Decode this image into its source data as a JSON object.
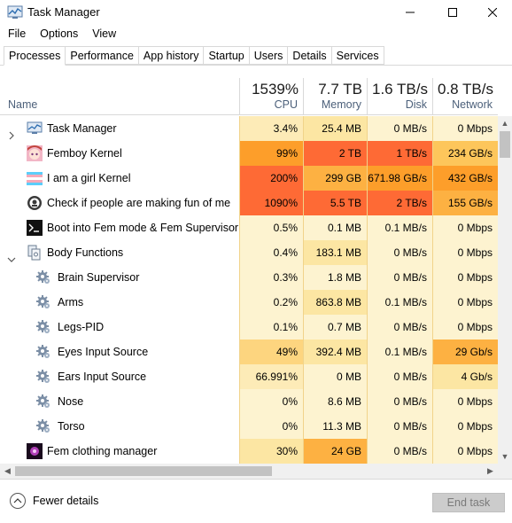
{
  "window": {
    "title": "Task Manager"
  },
  "menu": [
    "File",
    "Options",
    "View"
  ],
  "tabs": [
    "Processes",
    "Performance",
    "App history",
    "Startup",
    "Users",
    "Details",
    "Services"
  ],
  "header": {
    "name_label": "Name",
    "cpu": {
      "pct": "1539%",
      "label": "CPU"
    },
    "memory": {
      "pct": "7.7 TB",
      "label": "Memory"
    },
    "disk": {
      "pct": "1.6 TB/s",
      "label": "Disk"
    },
    "network": {
      "pct": "0.8 TB/s",
      "label": "Network"
    }
  },
  "rows": [
    {
      "name": "Task Manager",
      "icon": "task-manager-icon",
      "expander": "collapsed",
      "indent": 0,
      "cpu": "3.4%",
      "mem": "25.4 MB",
      "disk": "0 MB/s",
      "net": "0 Mbps",
      "colors": [
        "#fdebb7",
        "#fce6a3",
        "#fdf3d0",
        "#fdf3d0"
      ]
    },
    {
      "name": "Femboy Kernel",
      "icon": "anime-avatar-icon",
      "expander": "",
      "indent": 0,
      "cpu": "99%",
      "mem": "2 TB",
      "disk": "1 TB/s",
      "net": "234 GB/s",
      "colors": [
        "#fd9e2a",
        "#fe6a35",
        "#fe6a35",
        "#fdc65b"
      ]
    },
    {
      "name": "I am a girl Kernel",
      "icon": "trans-flag-icon",
      "expander": "",
      "indent": 0,
      "cpu": "200%",
      "mem": "299 GB",
      "disk": "671.98 GB/s",
      "net": "432 GB/s",
      "colors": [
        "#fe6a35",
        "#fdb142",
        "#fd9e2a",
        "#fd9e2a"
      ]
    },
    {
      "name": "Check if people are making fun of me",
      "icon": "circle-logo-icon",
      "expander": "",
      "indent": 0,
      "cpu": "1090%",
      "mem": "5.5 TB",
      "disk": "2 TB/s",
      "net": "155 GB/s",
      "colors": [
        "#fe6a35",
        "#fe6a35",
        "#fe6a35",
        "#fdb142"
      ]
    },
    {
      "name": "Boot into Fem mode & Fem Supervisor",
      "icon": "terminal-icon",
      "expander": "",
      "indent": 0,
      "cpu": "0.5%",
      "mem": "0.1 MB",
      "disk": "0.1 MB/s",
      "net": "0 Mbps",
      "colors": [
        "#fdf3d0",
        "#fdf3d0",
        "#fdf3d0",
        "#fdf3d0"
      ]
    },
    {
      "name": "Body Functions",
      "icon": "service-group-icon",
      "expander": "expanded",
      "indent": 0,
      "cpu": "0.4%",
      "mem": "183.1 MB",
      "disk": "0 MB/s",
      "net": "0 Mbps",
      "colors": [
        "#fdf3d0",
        "#fce6a3",
        "#fdf3d0",
        "#fdf3d0"
      ]
    },
    {
      "name": "Brain Supervisor",
      "icon": "gear-icon",
      "expander": "",
      "indent": 1,
      "cpu": "0.3%",
      "mem": "1.8 MB",
      "disk": "0 MB/s",
      "net": "0 Mbps",
      "colors": [
        "#fdf3d0",
        "#fdf3d0",
        "#fdf3d0",
        "#fdf3d0"
      ]
    },
    {
      "name": "Arms",
      "icon": "gear-icon",
      "expander": "",
      "indent": 1,
      "cpu": "0.2%",
      "mem": "863.8 MB",
      "disk": "0.1 MB/s",
      "net": "0 Mbps",
      "colors": [
        "#fdf3d0",
        "#fce6a3",
        "#fdf3d0",
        "#fdf3d0"
      ]
    },
    {
      "name": "Legs-PID",
      "icon": "gear-icon",
      "expander": "",
      "indent": 1,
      "cpu": "0.1%",
      "mem": "0.7 MB",
      "disk": "0 MB/s",
      "net": "0 Mbps",
      "colors": [
        "#fdf3d0",
        "#fdf3d0",
        "#fdf3d0",
        "#fdf3d0"
      ]
    },
    {
      "name": "Eyes Input Source",
      "icon": "gear-icon",
      "expander": "",
      "indent": 1,
      "cpu": "49%",
      "mem": "392.4 MB",
      "disk": "0.1 MB/s",
      "net": "29 Gb/s",
      "colors": [
        "#fdd57f",
        "#fce6a3",
        "#fdf3d0",
        "#fdb142"
      ]
    },
    {
      "name": "Ears Input Source",
      "icon": "gear-icon",
      "expander": "",
      "indent": 1,
      "cpu": "66.991%",
      "mem": "0 MB",
      "disk": "0 MB/s",
      "net": "4 Gb/s",
      "colors": [
        "#fdebb7",
        "#fdf3d0",
        "#fdf3d0",
        "#fce6a3"
      ]
    },
    {
      "name": "Nose",
      "icon": "gear-icon",
      "expander": "",
      "indent": 1,
      "cpu": "0%",
      "mem": "8.6 MB",
      "disk": "0 MB/s",
      "net": "0 Mbps",
      "colors": [
        "#fdf3d0",
        "#fdf3d0",
        "#fdf3d0",
        "#fdf3d0"
      ]
    },
    {
      "name": "Torso",
      "icon": "gear-icon",
      "expander": "",
      "indent": 1,
      "cpu": "0%",
      "mem": "11.3 MB",
      "disk": "0 MB/s",
      "net": "0 Mbps",
      "colors": [
        "#fdf3d0",
        "#fdf3d0",
        "#fdf3d0",
        "#fdf3d0"
      ]
    },
    {
      "name": "Fem clothing manager",
      "icon": "purple-app-icon",
      "expander": "",
      "indent": 0,
      "cpu": "30%",
      "mem": "24 GB",
      "disk": "0 MB/s",
      "net": "0 Mbps",
      "colors": [
        "#fce6a3",
        "#fdb142",
        "#fdf3d0",
        "#fdf3d0"
      ]
    }
  ],
  "footer": {
    "fewer_details": "Fewer details",
    "end_task": "End task"
  }
}
